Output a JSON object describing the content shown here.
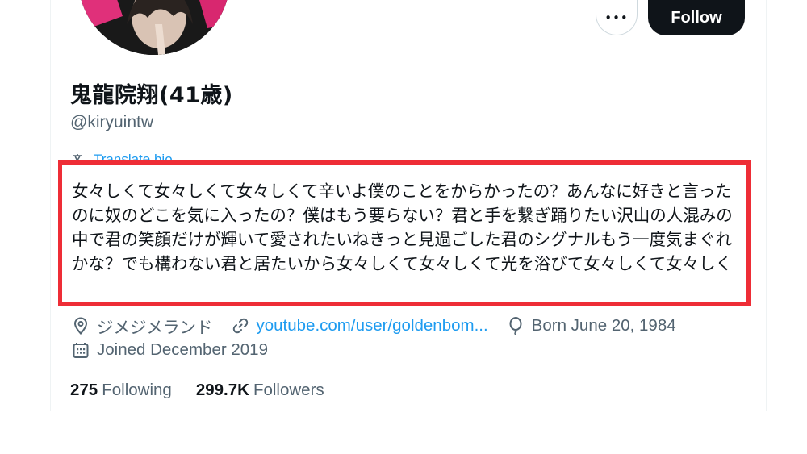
{
  "actions": {
    "more_label": "•••",
    "follow_label": "Follow"
  },
  "profile": {
    "display_name": "鬼龍院翔(41歳)",
    "handle": "@kiryuintw",
    "translate_label": "Translate bio",
    "bio": "女々しくて女々しくて女々しくて辛いよ僕のことをからかったの？あんなに好きと言ったのに奴のどこを気に入ったの？僕はもう要らない？君と手を繋ぎ踊りたい沢山の人混みの中で君の笑顔だけが輝いて愛されたいねきっと見過ごした君のシグナルもう一度気まぐれかな？でも構わない君と居たいから女々しくて女々しくて光を浴びて女々しくて女々しく",
    "location": "ジメジメランド",
    "website": "youtube.com/user/goldenbom...",
    "birthday": "Born June 20, 1984",
    "joined": "Joined December 2019"
  },
  "stats": {
    "following_count": "275",
    "following_label": "Following",
    "followers_count": "299.7K",
    "followers_label": "Followers"
  },
  "colors": {
    "accent": "#1d9bf0",
    "highlight_border": "#ee2d36",
    "follow_button_bg": "#0f1419",
    "secondary_text": "#536471"
  },
  "icons": [
    "more-icon",
    "translate-icon",
    "location-icon",
    "link-icon",
    "balloon-icon",
    "calendar-icon"
  ]
}
